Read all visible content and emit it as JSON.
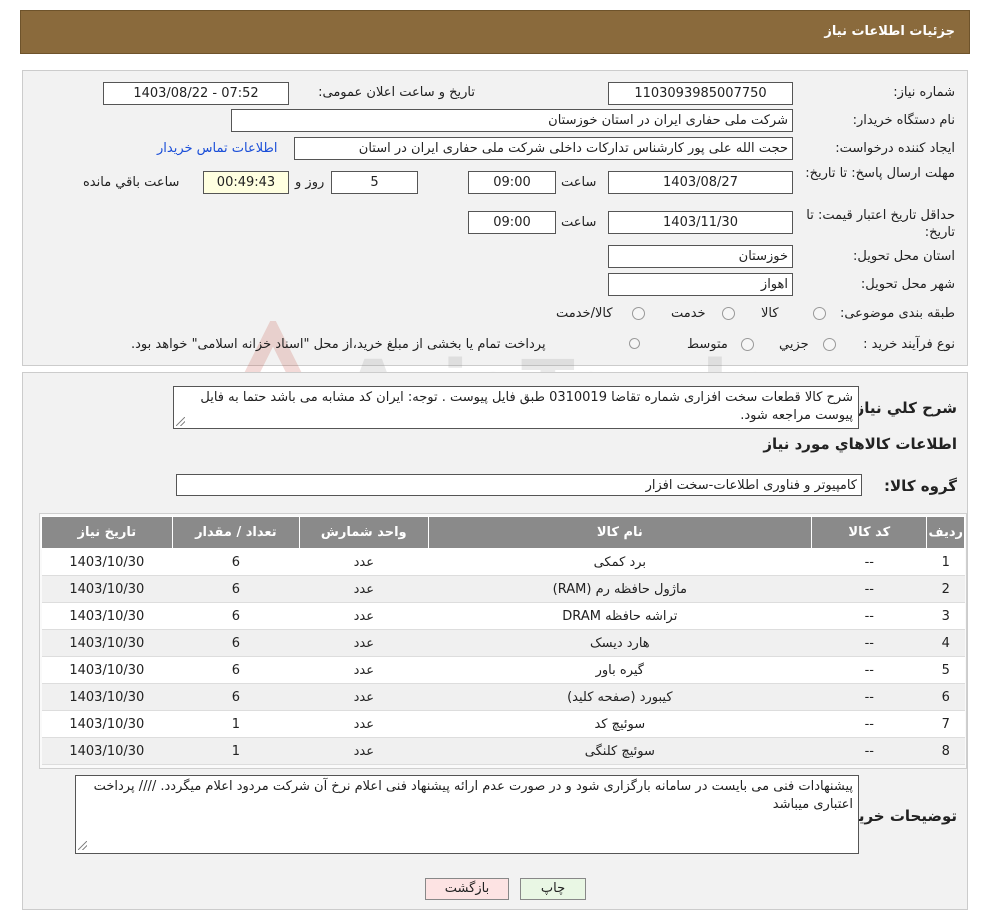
{
  "header": {
    "title": "جزئیات اطلاعات نیاز"
  },
  "form": {
    "need_number_label": "شماره نیاز:",
    "need_number": "1103093985007750",
    "announce_label": "تاریخ و ساعت اعلان عمومی:",
    "announce_value": "1403/08/22 - 07:52",
    "buyer_org_label": "نام دستگاه خریدار:",
    "buyer_org": "شرکت ملی حفاری ایران در استان خوزستان",
    "creator_label": "ایجاد کننده درخواست:",
    "creator": "حجت الله علی پور کارشناس تدارکات داخلی شرکت ملی حفاری ایران در استان",
    "contact_link": "اطلاعات تماس خریدار",
    "deadline_label": "مهلت ارسال پاسخ: تا تاریخ:",
    "deadline_date": "1403/08/27",
    "time_label": "ساعت",
    "deadline_time": "09:00",
    "days_value": "5",
    "days_label": "روز و",
    "remaining_time": "00:49:43",
    "remaining_label": "ساعت باقي مانده",
    "min_valid_label": "حداقل تاریخ اعتبار قیمت: تا تاریخ:",
    "min_valid_date": "1403/11/30",
    "min_valid_time": "09:00",
    "province_label": "استان محل تحویل:",
    "province": "خوزستان",
    "city_label": "شهر محل تحویل:",
    "city": "اهواز",
    "category_label": "طبقه بندی موضوعی:",
    "category_options": [
      "کالا",
      "خدمت",
      "کالا/خدمت"
    ],
    "purchase_type_label": "نوع فرآیند خرید :",
    "purchase_options": [
      "جزیي",
      "متوسط"
    ],
    "purchase_note": "پرداخت تمام یا بخشی از مبلغ خرید،از محل \"اسناد خزانه اسلامی\" خواهد بود."
  },
  "watermark": {
    "text": "AriaTender.neT"
  },
  "details": {
    "summary_label": "شرح کلي نياز:",
    "summary": "شرح کالا قطعات سخت افزاری شماره تقاضا 0310019 طبق فایل پیوست . توجه: ایران کد مشابه می باشد حتما به فایل پیوست مراجعه شود.",
    "items_title": "اطلاعات کالاهاي مورد نياز",
    "group_label": "گروه کالا:",
    "group": "کامپیوتر و فناوری اطلاعات-سخت افزار",
    "table": {
      "headers": [
        "ردیف",
        "کد کالا",
        "نام کالا",
        "واحد شمارش",
        "تعداد / مقدار",
        "تاریخ نیاز"
      ],
      "rows": [
        [
          "1",
          "--",
          "برد کمکی",
          "عدد",
          "6",
          "1403/10/30"
        ],
        [
          "2",
          "--",
          "ماژول حافظه رم (RAM)",
          "عدد",
          "6",
          "1403/10/30"
        ],
        [
          "3",
          "--",
          "تراشه حافظه DRAM",
          "عدد",
          "6",
          "1403/10/30"
        ],
        [
          "4",
          "--",
          "هارد دیسک",
          "عدد",
          "6",
          "1403/10/30"
        ],
        [
          "5",
          "--",
          "گیره باور",
          "عدد",
          "6",
          "1403/10/30"
        ],
        [
          "6",
          "--",
          "کیبورد (صفحه کلید)",
          "عدد",
          "6",
          "1403/10/30"
        ],
        [
          "7",
          "--",
          "سوئیچ کد",
          "عدد",
          "1",
          "1403/10/30"
        ],
        [
          "8",
          "--",
          "سوئیچ کلنگی",
          "عدد",
          "1",
          "1403/10/30"
        ]
      ]
    },
    "buyer_notes_label": "توضیحات خریدار:",
    "buyer_notes": "پیشنهادات فنی می بایست در سامانه بارگزاری شود و در صورت عدم ارائه پیشنهاد فنی اعلام نرخ آن شرکت مردود اعلام میگردد.  //// پرداخت اعتباری میباشد"
  },
  "buttons": {
    "print": "چاپ",
    "back": "بازگشت"
  }
}
